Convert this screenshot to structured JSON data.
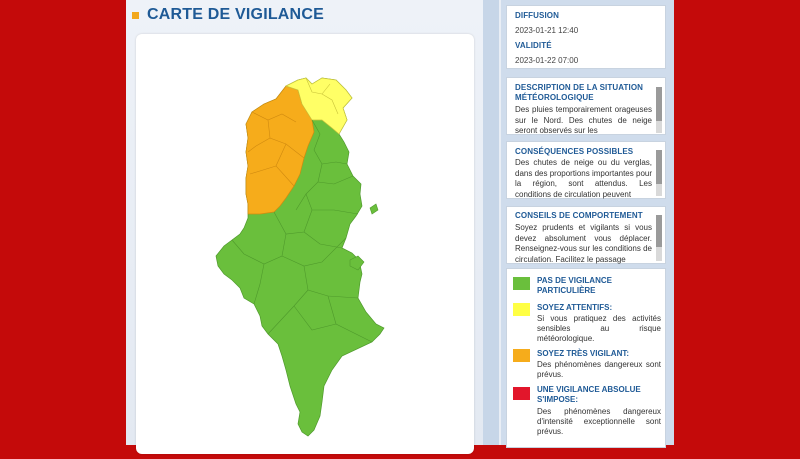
{
  "page": {
    "title": "CARTE DE VIGILANCE"
  },
  "diffusion": {
    "label": "DIFFUSION",
    "value": "2023-01-21 12:40"
  },
  "validite": {
    "label": "VALIDITÉ",
    "value": "2023-01-22 07:00"
  },
  "sections": [
    {
      "title": "DESCRIPTION DE LA SITUATION MÉTÉOROLOGIQUE",
      "text": "Des pluies temporairement orageuses sur le Nord. Des chutes de neige seront observés sur les"
    },
    {
      "title": "CONSÉQUENCES POSSIBLES",
      "text": "Des chutes de neige ou du verglas, dans des proportions importantes pour la région, sont attendus. Les conditions de circulation peuvent"
    },
    {
      "title": "CONSEILS DE COMPORTEMENT",
      "text": "Soyez prudents et vigilants si vous devez absolument vous déplacer. Renseignez-vous sur les conditions de circulation. Facilitez le passage"
    }
  ],
  "legend": [
    {
      "color": "#6abf3c",
      "title": "PAS DE VIGILANCE PARTICULIÈRE",
      "desc": ""
    },
    {
      "color": "#ffff44",
      "title": "SOYEZ ATTENTIFS:",
      "desc": "Si vous pratiquez des activités sensibles au risque météorologique."
    },
    {
      "color": "#f6ac1b",
      "title": "SOYEZ TRÈS VIGILANT:",
      "desc": "Des phénomènes dangereux sont prévus."
    },
    {
      "color": "#e2162b",
      "title": "UNE VIGILANCE ABSOLUE S'IMPOSE:",
      "desc": "Des phénomènes dangereux d'intensité exceptionnelle sont prévus."
    }
  ],
  "map": {
    "colors": {
      "green": "#6abf3c",
      "yellow": "#ffff66",
      "orange": "#f6ac1b",
      "border": "#4f9a2c"
    }
  }
}
